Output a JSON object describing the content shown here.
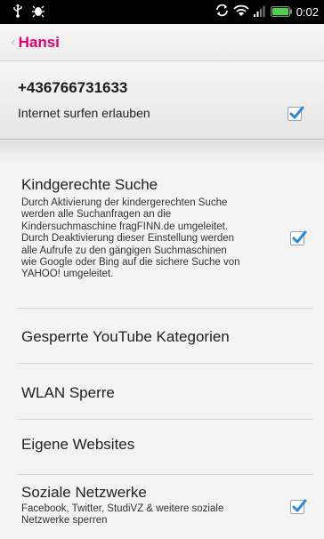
{
  "status_bar": {
    "time": "0:02",
    "icons": [
      "usb-icon",
      "debug-icon",
      "sync-icon",
      "wifi-icon",
      "signal-icon",
      "battery-icon"
    ],
    "battery_color": "#4cd14a"
  },
  "header": {
    "back_glyph": "‹",
    "title": "Hansi",
    "title_color": "#e20074"
  },
  "phone": {
    "number": "+436766731633",
    "internet_label": "Internet surfen erlauben",
    "internet_checked": true
  },
  "settings": [
    {
      "title": "Kindgerechte Suche",
      "description": "Durch Aktivierung der kindergerechten Suche werden alle Suchanfragen an die Kindersuchmaschine fragFINN.de umgeleitet. Durch Deaktivierung dieser Einstellung werden alle Aufrufe zu den gängigen Suchmaschinen wie Google oder Bing auf die sichere Suche von YAHOO! umgeleitet.",
      "checked": true
    },
    {
      "title": "Gesperrte YouTube Kategorien"
    },
    {
      "title": "WLAN Sperre"
    },
    {
      "title": "Eigene Websites"
    },
    {
      "title": "Soziale Netzwerke",
      "description": "Facebook, Twitter, StudiVZ & weitere soziale Netzwerke sperren",
      "checked": true
    }
  ],
  "check_color": "#2a8ad6"
}
